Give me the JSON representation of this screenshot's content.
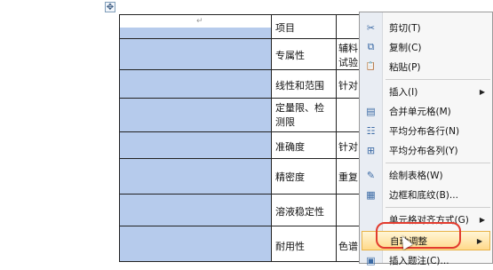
{
  "table": {
    "rows": [
      {
        "c2": "项目",
        "c3": ""
      },
      {
        "c2": "专属性",
        "c3": "辅料 试验"
      },
      {
        "c2": "线性和范围",
        "c3": "针对"
      },
      {
        "c2": "定量限、检测限",
        "c3": ""
      },
      {
        "c2": "准确度",
        "c3": "针对"
      },
      {
        "c2": "精密度",
        "c3": "重复"
      },
      {
        "c2": "溶液稳定性",
        "c3": ""
      },
      {
        "c2": "耐用性",
        "c3": "色谱"
      }
    ],
    "return_mark": "↵",
    "cell_mark": "ﾟ"
  },
  "context_menu": {
    "items": [
      {
        "label": "剪切(T)",
        "icon": "scissors-icon",
        "glyph": "✂"
      },
      {
        "label": "复制(C)",
        "icon": "copy-icon",
        "glyph": "⧉"
      },
      {
        "label": "粘贴(P)",
        "icon": "paste-icon",
        "glyph": "📋"
      },
      {
        "label": "插入(I)",
        "icon": "",
        "glyph": "",
        "submenu": true
      },
      {
        "label": "合并单元格(M)",
        "icon": "merge-cells-icon",
        "glyph": "▤"
      },
      {
        "label": "平均分布各行(N)",
        "icon": "distribute-rows-icon",
        "glyph": "☷"
      },
      {
        "label": "平均分布各列(Y)",
        "icon": "distribute-columns-icon",
        "glyph": "⊞"
      },
      {
        "label": "绘制表格(W)",
        "icon": "draw-table-icon",
        "glyph": "✎"
      },
      {
        "label": "边框和底纹(B)...",
        "icon": "borders-icon",
        "glyph": "▦"
      },
      {
        "label": "单元格对齐方式(G)",
        "icon": "",
        "glyph": "",
        "submenu": true
      },
      {
        "label": "自动调整",
        "icon": "",
        "glyph": "",
        "submenu": true,
        "highlighted": true
      },
      {
        "label": "插入题注(C)...",
        "icon": "caption-icon",
        "glyph": "▣"
      }
    ],
    "submenu_arrow": "▶"
  },
  "move_handle_glyph": "✥"
}
